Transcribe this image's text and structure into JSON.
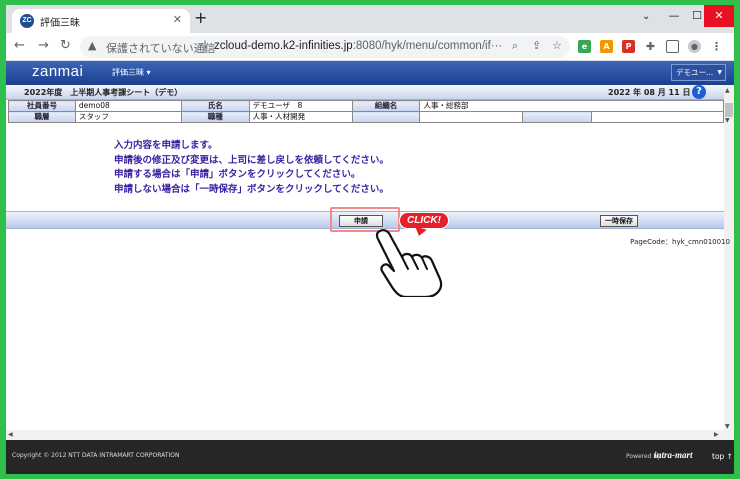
{
  "browser": {
    "tab_title": "評価三昧",
    "favicon_text": "ZC",
    "tab_close": "✕",
    "new_tab": "+",
    "url_insecure_label": "保護されていない通信",
    "url_host": "zcloud-demo.k2-infinities.jp",
    "url_path": ":8080/hyk/menu/common/if···",
    "window_min": "—",
    "window_max": "☐",
    "window_close": "✕"
  },
  "app": {
    "brand": "zanmai",
    "menu_label": "評価三昧 ▾",
    "user_dropdown": "デモユー..."
  },
  "sheet": {
    "title": "2022年度　上半期人事考課シート（デモ）",
    "date": "2022 年 08 月 11 日",
    "help": "?"
  },
  "info_table": {
    "row1": {
      "h1": "社員番号",
      "v1": "demo08",
      "h2": "氏名",
      "v2": "デモユーザ　8",
      "h3": "組織名",
      "v3": "人事・総務部"
    },
    "row2": {
      "h1": "職層",
      "v1": "スタッフ",
      "h2": "職種",
      "v2": "人事・人材開発",
      "h3": "",
      "v3": ""
    }
  },
  "message": {
    "line1": "入力内容を申請します。",
    "line2": "申請後の修正及び変更は、上司に差し戻しを依頼してください。",
    "line3": "申請する場合は「申請」ボタンをクリックしてください。",
    "line4": "申請しない場合は「一時保存」ボタンをクリックしてください。"
  },
  "actions": {
    "apply_label": "申請",
    "temp_save_label": "一時保存",
    "click_badge": "CLICK!"
  },
  "page_code": "PageCode：hyk_cmn010010",
  "footer": {
    "copyright": "Copyright © 2012 NTT DATA INTRAMART CORPORATION",
    "powered_by": "Powered by",
    "logo": "intra-mart",
    "top_link": "top ↑"
  },
  "colors": {
    "outer_frame": "#2fbf4b",
    "appbar": "#1c3f8f",
    "message": "#3a1ea3",
    "click_badge": "#e5202b"
  }
}
